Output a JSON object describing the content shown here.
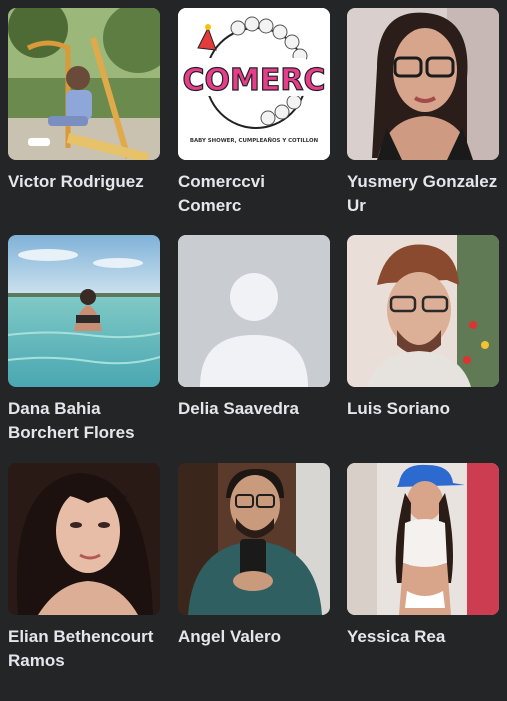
{
  "friends": [
    {
      "name": "Victor Rodriguez",
      "photo": "child-on-playground-photo"
    },
    {
      "name": "Comerccvi Comerc",
      "photo": "comerc-logo-photo",
      "logo_text": "COMERC",
      "logo_tagline": "BABY SHOWER, CUMPLEAÑOS Y COTILLON"
    },
    {
      "name": "Yusmery Gonzalez Ur",
      "photo": "woman-glasses-selfie-photo"
    },
    {
      "name": "Dana Bahia Borchert Flores",
      "photo": "woman-in-sea-photo"
    },
    {
      "name": "Delia Saavedra",
      "photo": "default-avatar-icon"
    },
    {
      "name": "Luis Soriano",
      "photo": "man-glasses-selfie-photo"
    },
    {
      "name": "Elian Bethencourt Ramos",
      "photo": "woman-curly-hair-photo"
    },
    {
      "name": "Angel Valero",
      "photo": "man-mirror-selfie-photo"
    },
    {
      "name": "Yessica Rea",
      "photo": "woman-blue-cap-photo"
    }
  ],
  "colors": {
    "background": "#242526",
    "name_text": "#e4e6eb",
    "default_avatar_bg": "#c9ccd1",
    "default_avatar_fg": "#f0f2f5"
  }
}
